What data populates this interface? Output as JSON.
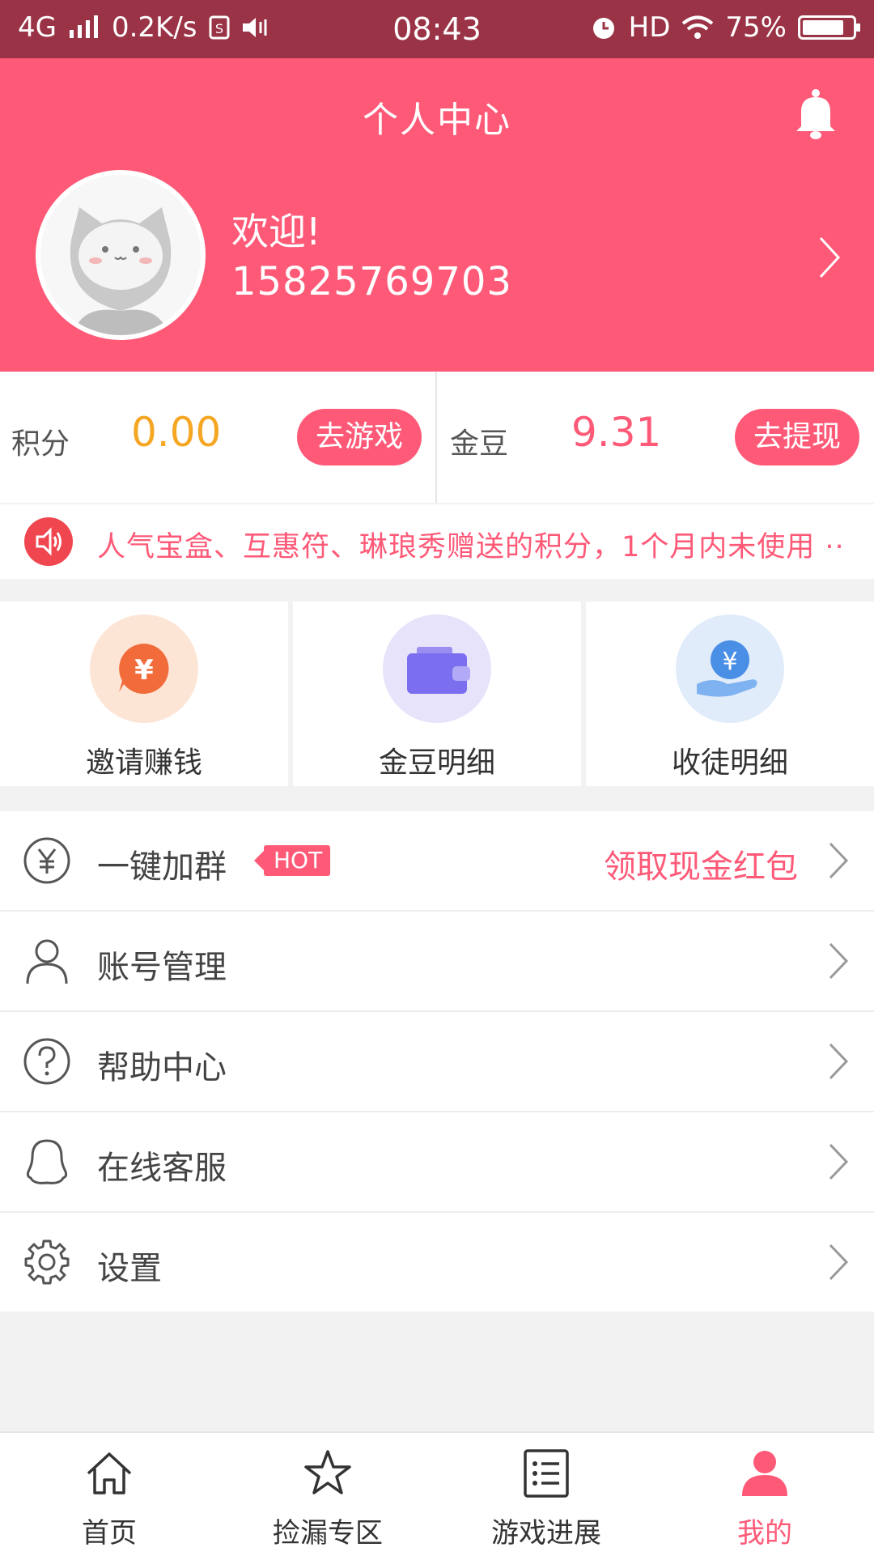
{
  "status_bar": {
    "network": "4G",
    "speed": "0.2K/s",
    "time": "08:43",
    "hd": "HD",
    "battery": "75%"
  },
  "header": {
    "title": "个人中心",
    "welcome": "欢迎!",
    "phone": "15825769703",
    "bg_color": "#fe5a78"
  },
  "points": {
    "left": {
      "label": "积分",
      "value": "0.00",
      "button": "去游戏",
      "value_color": "#f5a623"
    },
    "right": {
      "label": "金豆",
      "value": "9.31",
      "button": "去提现",
      "value_color": "#fe5a78"
    }
  },
  "notice": {
    "text": "人气宝盒、互惠符、琳琅秀赠送的积分，1个月内未使用 ··"
  },
  "features": [
    {
      "label": "邀请赚钱",
      "icon": "yuan-chat-icon"
    },
    {
      "label": "金豆明细",
      "icon": "wallet-icon"
    },
    {
      "label": "收徒明细",
      "icon": "coin-hand-icon"
    }
  ],
  "menu": [
    {
      "label": "一键加群",
      "badge": "HOT",
      "right_text": "领取现金红包",
      "icon": "yuan-circle-icon"
    },
    {
      "label": "账号管理",
      "icon": "user-icon"
    },
    {
      "label": "帮助中心",
      "icon": "help-icon"
    },
    {
      "label": "在线客服",
      "icon": "chat-bubble-icon"
    },
    {
      "label": "设置",
      "icon": "gear-icon"
    }
  ],
  "tabs": [
    {
      "label": "首页",
      "icon": "home-icon"
    },
    {
      "label": "捡漏专区",
      "icon": "star-icon"
    },
    {
      "label": "游戏进展",
      "icon": "list-icon"
    },
    {
      "label": "我的",
      "icon": "person-icon",
      "active": true
    }
  ]
}
